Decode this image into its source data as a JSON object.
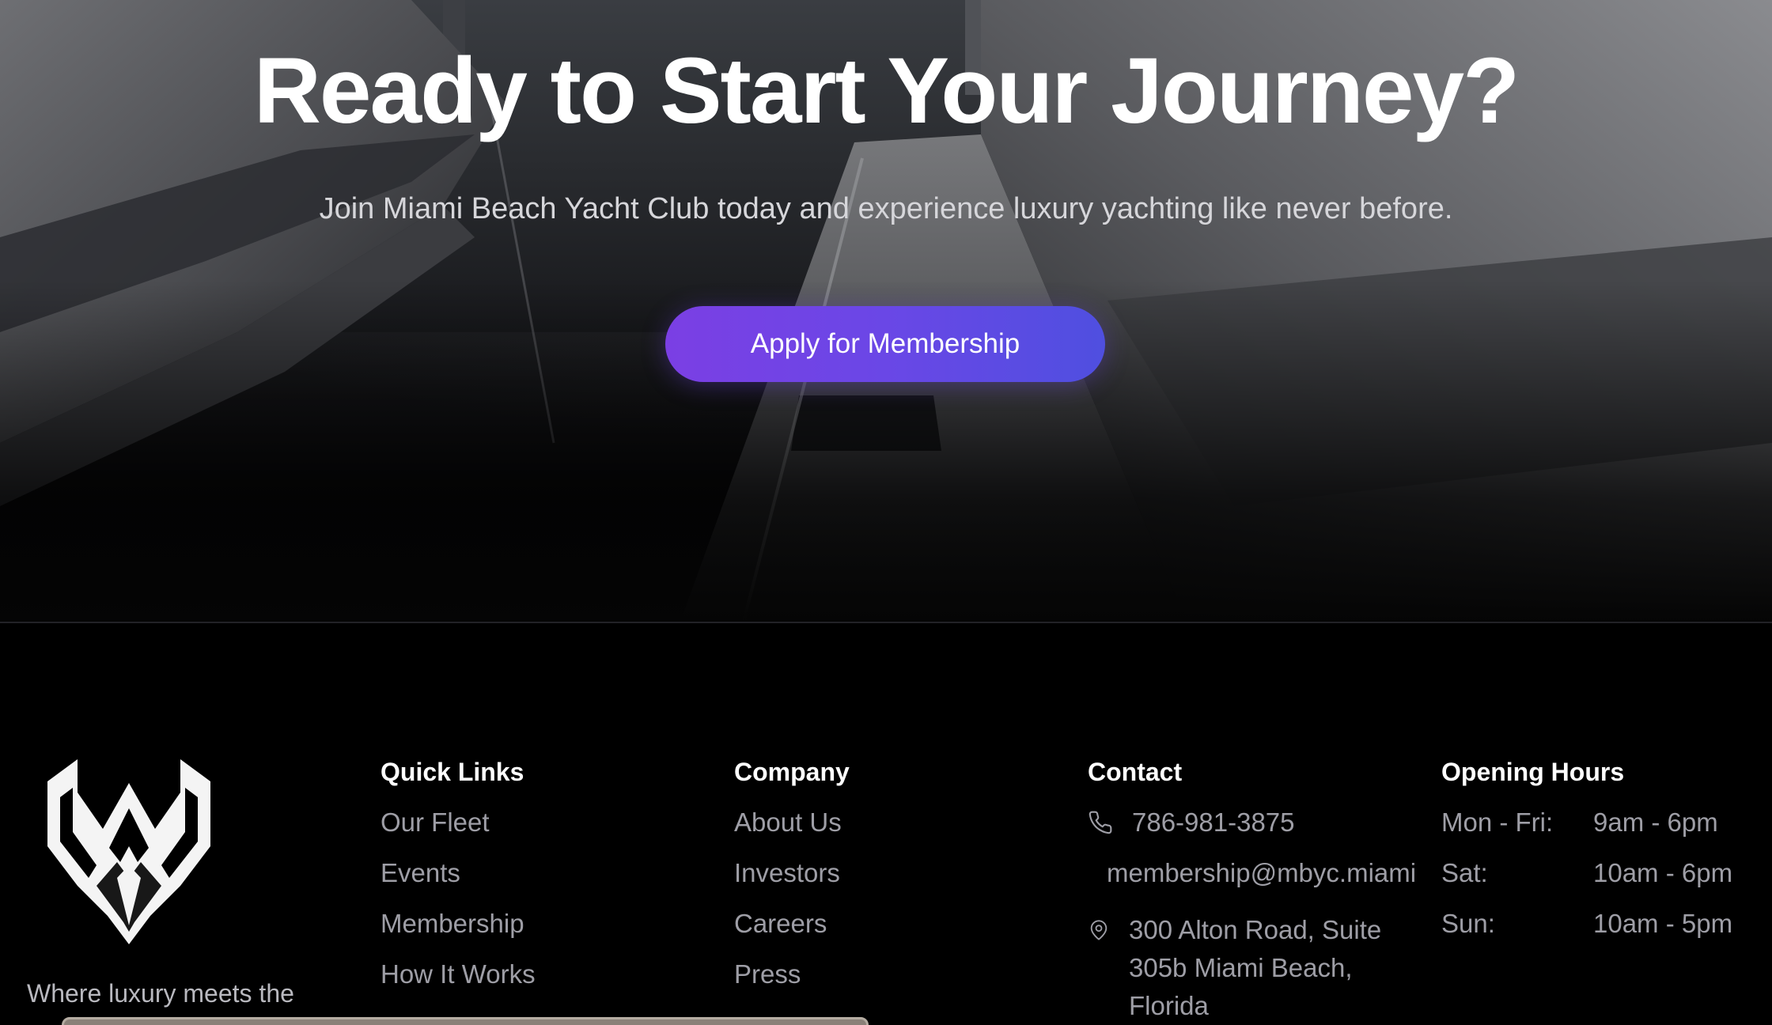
{
  "hero": {
    "title": "Ready to Start Your Journey?",
    "subtitle": "Join Miami Beach Yacht Club today and experience luxury yachting like never before.",
    "cta_label": "Apply for Membership",
    "cta_gradient": [
      "#7b3fe4",
      "#4f4fe0"
    ]
  },
  "footer": {
    "tagline": "Where luxury meets the",
    "quick_links": {
      "heading": "Quick Links",
      "items": [
        "Our Fleet",
        "Events",
        "Membership",
        "How It Works"
      ]
    },
    "company": {
      "heading": "Company",
      "items": [
        "About Us",
        "Investors",
        "Careers",
        "Press"
      ]
    },
    "contact": {
      "heading": "Contact",
      "phone": "786-981-3875",
      "email": "membership@mbyc.miami",
      "address": "300 Alton Road, Suite 305b Miami Beach, Florida",
      "icons": [
        "phone-icon",
        "map-pin-icon"
      ]
    },
    "hours": {
      "heading": "Opening Hours",
      "rows": [
        {
          "day": "Mon - Fri:",
          "time": "9am - 6pm"
        },
        {
          "day": "Sat:",
          "time": "10am - 6pm"
        },
        {
          "day": "Sun:",
          "time": "10am - 5pm"
        }
      ]
    }
  }
}
